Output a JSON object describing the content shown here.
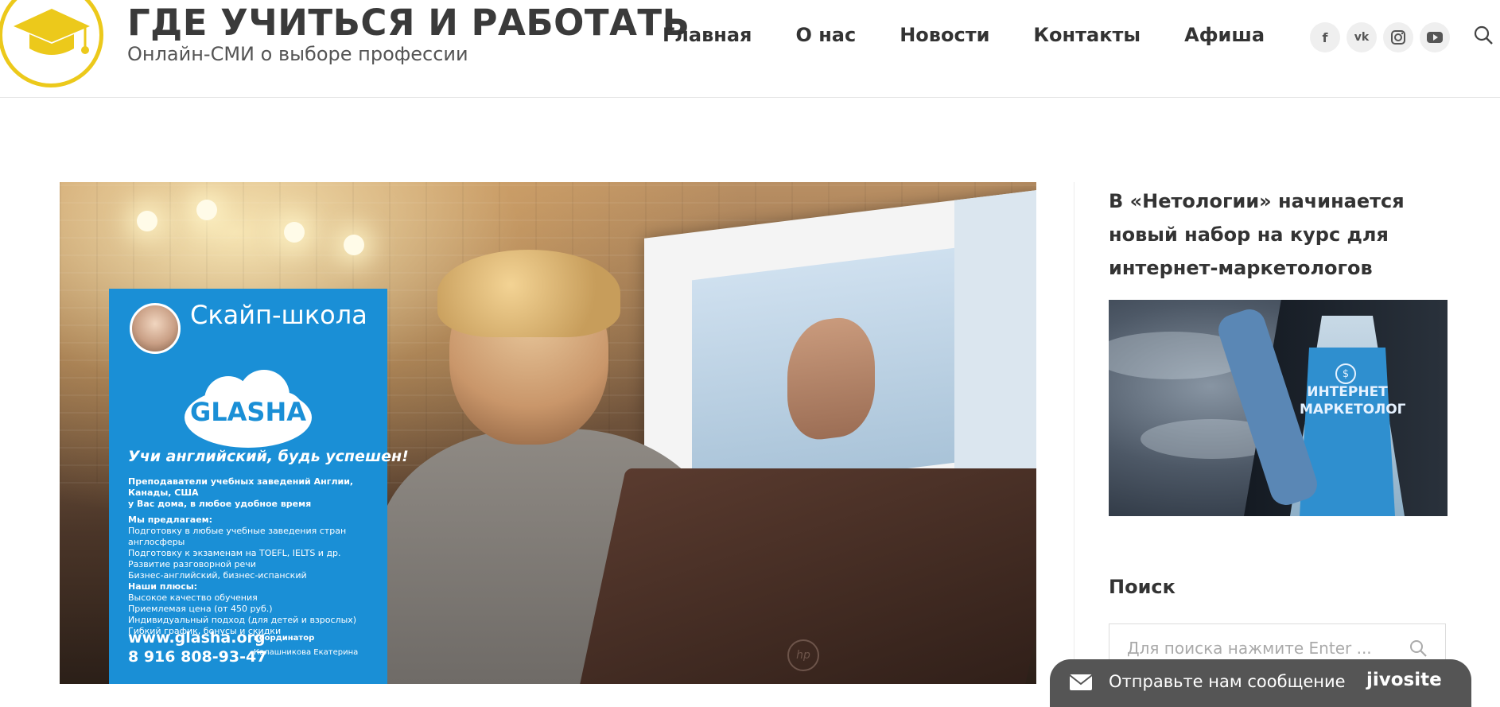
{
  "header": {
    "site_title": "ГДЕ УЧИТЬСЯ И РАБОТАТЬ",
    "site_subtitle": "Онлайн-СМИ о выборе профессии",
    "nav": [
      "Главная",
      "О нас",
      "Новости",
      "Контакты",
      "Афиша"
    ],
    "socials": [
      {
        "name": "facebook-icon",
        "glyph": "f"
      },
      {
        "name": "vk-icon",
        "glyph": "vk"
      },
      {
        "name": "instagram-icon",
        "glyph": "ig"
      },
      {
        "name": "youtube-icon",
        "glyph": "▶"
      }
    ],
    "accent_color": "#ecc91b"
  },
  "hero": {
    "poster": {
      "title": "Скайп-школа",
      "brand": "GLASHA",
      "slogan": "Учи английский, будь успешен!",
      "intro_line1": "Преподаватели учебных заведений Англии, Канады, США",
      "intro_line2": "у Вас дома, в любое удобное время",
      "offer_heading": "Мы предлагаем:",
      "offers": [
        "Подготовку в любые учебные заведения стран англосферы",
        "Подготовку к экзаменам на TOEFL, IELTS и др.",
        "Развитие разговорной речи",
        "Бизнес-английский, бизнес-испанский"
      ],
      "plus_heading": "Наши плюсы:",
      "pluses": [
        "Высокое качество обучения",
        "Приемлемая цена (от 450 руб.)",
        "Индивидуальный подход (для детей и взрослых)",
        "Гибкий график, бонусы и скидки"
      ],
      "url": "www.glasha.org",
      "phone": "8 916 808-93-47",
      "coordinator_label": "координатор",
      "coordinator_name": "Калашникова Екатерина",
      "color": "#1a8fd6"
    },
    "laptop_logo": "hp"
  },
  "sidebar": {
    "news_title": "В «Нетологии» начинается новый набор на курс для интернет-маркетологов",
    "news_image_text_line1": "ИНТЕРНЕТ",
    "news_image_text_line2": "МАРКЕТОЛОГ",
    "news_image_symbol": "$",
    "search_heading": "Поиск",
    "search_placeholder": "Для поиска нажмите Enter ..."
  },
  "chat_widget": {
    "label": "Отправьте нам сообщение",
    "brand": "jivosite",
    "color": "#555555"
  }
}
